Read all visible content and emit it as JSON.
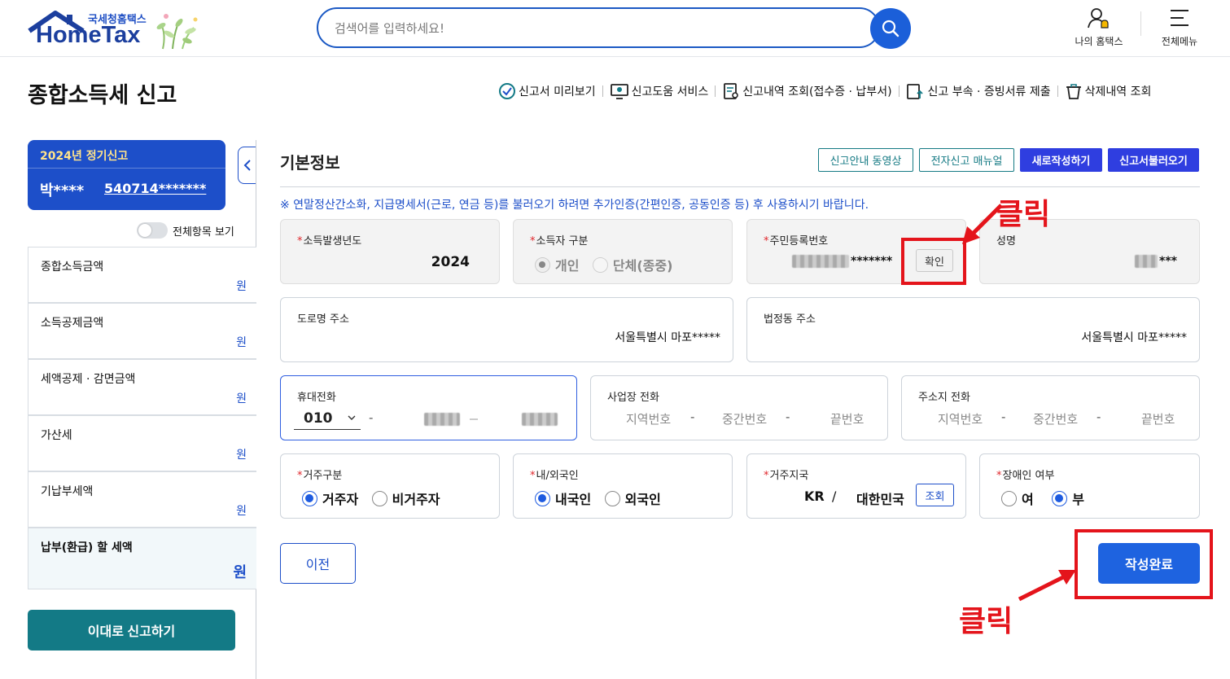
{
  "header": {
    "logo_sub": "국세청홈택스",
    "logo_main": "HomeTax",
    "search_placeholder": "검색어를 입력하세요!",
    "my_hometax": "나의 홈택스",
    "full_menu": "전체메뉴"
  },
  "page": {
    "title": "종합소득세 신고",
    "quick_links": [
      "신고서 미리보기",
      "신고도움 서비스",
      "신고내역 조회(접수증 · 납부서)",
      "신고 부속 · 증빙서류 제출",
      "삭제내역 조회"
    ]
  },
  "sidebar": {
    "filing_period": "2024년 정기신고",
    "name": "박****",
    "ssn": "540714*******",
    "show_all_label": "전체항목 보기",
    "items": [
      {
        "label": "종합소득금액",
        "unit": "원"
      },
      {
        "label": "소득공제금액",
        "unit": "원"
      },
      {
        "label": "세액공제 · 감면금액",
        "unit": "원"
      },
      {
        "label": "가산세",
        "unit": "원"
      },
      {
        "label": "기납부세액",
        "unit": "원"
      },
      {
        "label": "납부(환급) 할 세액",
        "unit": "원"
      }
    ],
    "file_button": "이대로 신고하기"
  },
  "form": {
    "section_title": "기본정보",
    "buttons": {
      "guide_video": "신고안내 동영상",
      "manual": "전자신고 매뉴얼",
      "new": "새로작성하기",
      "load": "신고서불러오기"
    },
    "notice": "※ 연말정산간소화, 지급명세서(근로, 연금 등)를 불러오기 하려면 추가인증(간편인증, 공동인증 등) 후 사용하시기 바랍니다.",
    "income_year": {
      "label": "소득발생년도",
      "value": "2024"
    },
    "taxpayer_type": {
      "label": "소득자 구분",
      "options": [
        "개인",
        "단체(종중)"
      ],
      "selected": "개인"
    },
    "resident_no": {
      "label": "주민등록번호",
      "masked_suffix": "*******",
      "confirm": "확인"
    },
    "name": {
      "label": "성명",
      "masked_suffix": "***"
    },
    "road_address": {
      "label": "도로명 주소",
      "value": "서울특별시 마포*****"
    },
    "lot_address": {
      "label": "법정동 주소",
      "value": "서울특별시 마포*****"
    },
    "mobile": {
      "label": "휴대전화",
      "prefix": "010",
      "dash": "-"
    },
    "business_phone": {
      "label": "사업장 전화",
      "area": "지역번호",
      "middle": "중간번호",
      "last": "끝번호",
      "dash": "-"
    },
    "home_phone": {
      "label": "주소지 전화",
      "area": "지역번호",
      "middle": "중간번호",
      "last": "끝번호",
      "dash": "-"
    },
    "residency": {
      "label": "거주구분",
      "options": [
        "거주자",
        "비거주자"
      ],
      "selected": "거주자"
    },
    "nationality": {
      "label": "내/외국인",
      "options": [
        "내국인",
        "외국인"
      ],
      "selected": "내국인"
    },
    "country": {
      "label": "거주지국",
      "code": "KR",
      "separator": "/",
      "name": "대한민국",
      "lookup": "조회"
    },
    "disability": {
      "label": "장애인 여부",
      "options": [
        "여",
        "부"
      ],
      "selected": "부"
    },
    "prev_button": "이전",
    "complete_button": "작성완료"
  },
  "annotations": {
    "click_text": "클릭",
    "highlight_color": "#e4141b"
  },
  "colors": {
    "primary_blue": "#1d4fc9",
    "teal": "#137a86",
    "button_blue": "#1e63e0",
    "purple_blue": "#2f3ee0"
  }
}
